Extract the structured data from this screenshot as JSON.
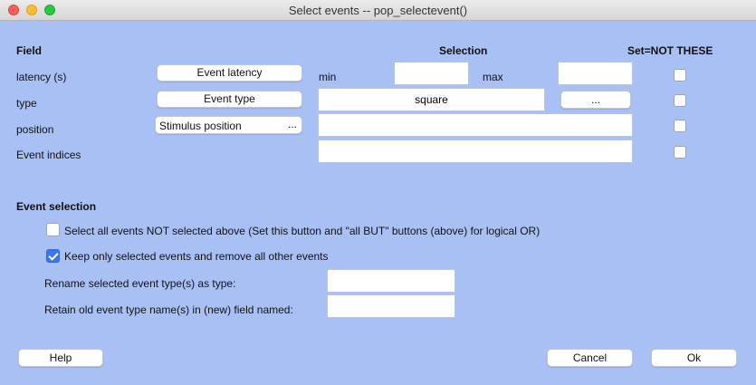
{
  "window": {
    "title": "Select events -- pop_selectevent()"
  },
  "headers": {
    "field": "Field",
    "selection": "Selection",
    "set_not": "Set=NOT THESE"
  },
  "rows": {
    "latency": {
      "label": "latency (s)",
      "button": "Event latency",
      "min_label": "min",
      "max_label": "max",
      "min_value": "",
      "max_value": ""
    },
    "type": {
      "label": "type",
      "button": "Event type",
      "value": "square",
      "dots": "..."
    },
    "position": {
      "label": "position",
      "popup": "Stimulus position",
      "dots": "...",
      "value": ""
    },
    "indices": {
      "label": "Event indices",
      "value": ""
    }
  },
  "event_selection": {
    "heading": "Event selection",
    "select_all_not": {
      "label": "Select all events NOT selected above (Set this button and \"all BUT\" buttons (above) for logical OR)",
      "checked": false
    },
    "keep_only": {
      "label": "Keep only selected events and remove all other events",
      "checked": true
    },
    "rename_label": "Rename selected event type(s) as type:",
    "rename_value": "",
    "retain_label": "Retain old event type name(s) in (new) field named:",
    "retain_value": ""
  },
  "buttons": {
    "help": "Help",
    "cancel": "Cancel",
    "ok": "Ok"
  },
  "colors": {
    "background": "#a9c0f5",
    "checkbox_checked": "#3478f6"
  }
}
